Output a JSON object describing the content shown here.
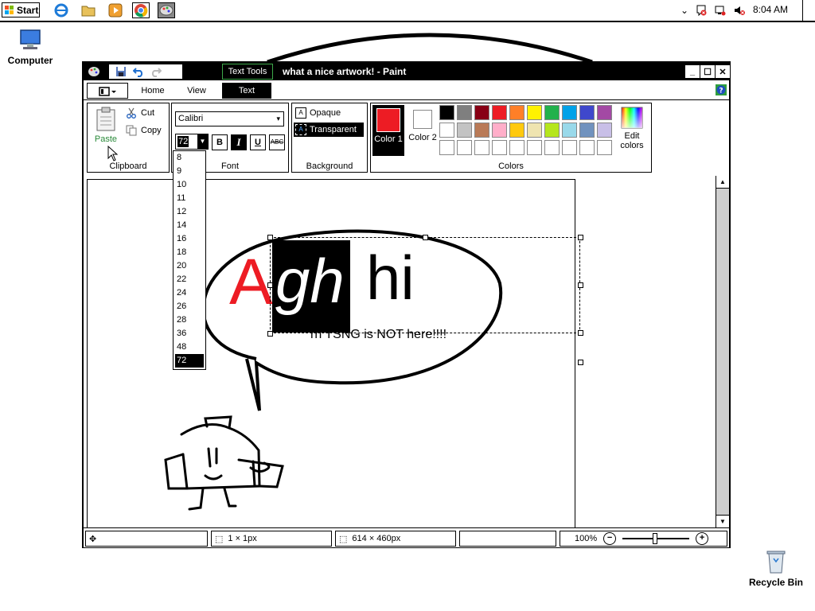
{
  "taskbar": {
    "start_label": "Start",
    "clock": "8:04 AM",
    "pinned": [
      "ie-icon",
      "explorer-icon",
      "media-player-icon",
      "chrome-icon",
      "paint-icon"
    ]
  },
  "desktop": {
    "computer_label": "Computer",
    "recycle_label": "Recycle Bin"
  },
  "window": {
    "title": "what a nice artwork! - Paint",
    "context_tab": "Text Tools",
    "tabs": {
      "home": "Home",
      "view": "View",
      "text": "Text"
    }
  },
  "ribbon": {
    "clipboard": {
      "paste": "Paste",
      "cut": "Cut",
      "copy": "Copy",
      "label": "Clipboard"
    },
    "font": {
      "family": "Calibri",
      "size": "72",
      "bold": "B",
      "italic": "I",
      "underline": "U",
      "strike": "ABC",
      "label": "Font"
    },
    "background": {
      "opaque": "Opaque",
      "transparent": "Transparent",
      "label": "Background"
    },
    "colors": {
      "color1_label": "Color 1",
      "color1": "#ed1c24",
      "color2_label": "Color 2",
      "color2": "#ffffff",
      "edit_label": "Edit colors",
      "label": "Colors",
      "palette_row1": [
        "#000000",
        "#7f7f7f",
        "#880015",
        "#ed1c24",
        "#ff7f27",
        "#fff200",
        "#22b14c",
        "#00a2e8",
        "#3f48cc",
        "#a349a4"
      ],
      "palette_row2": [
        "#ffffff",
        "#c3c3c3",
        "#b97a57",
        "#ffaec9",
        "#ffc90e",
        "#efe4b0",
        "#b5e61d",
        "#99d9ea",
        "#7092be",
        "#c8bfe7"
      ],
      "palette_row3": [
        "#ffffff",
        "#ffffff",
        "#ffffff",
        "#ffffff",
        "#ffffff",
        "#ffffff",
        "#ffffff",
        "#ffffff",
        "#ffffff",
        "#ffffff"
      ]
    }
  },
  "font_sizes": [
    "8",
    "9",
    "10",
    "11",
    "12",
    "14",
    "16",
    "18",
    "20",
    "22",
    "24",
    "26",
    "28",
    "36",
    "48",
    "72"
  ],
  "font_size_selected": "72",
  "canvas": {
    "big_a": "A",
    "selected_text": "gh",
    "text_hi": "hi",
    "subtitle": "rn TSNG is NOT here!!!!"
  },
  "status": {
    "selection_size": "1 × 1px",
    "image_size": "614 × 460px",
    "zoom": "100%"
  }
}
